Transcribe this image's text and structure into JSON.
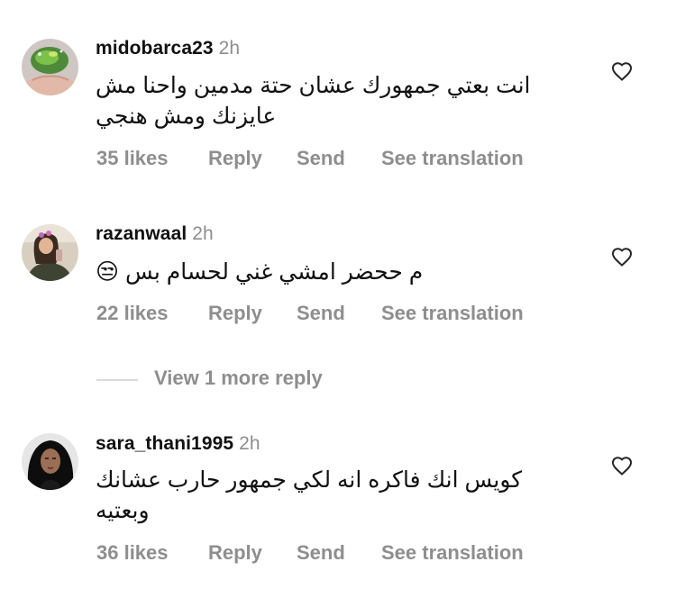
{
  "comments": [
    {
      "username": "midobarca23",
      "time": "2h",
      "text": "انت بعتي جمهورك عشان حتة مدمين واحنا مش عايزنك ومش هنجي",
      "likes": "35 likes",
      "reply": "Reply",
      "send": "Send",
      "translate": "See translation",
      "avatar": "globe-in-hand-avatar"
    },
    {
      "username": "razanwaal",
      "time": "2h",
      "text": "م ححضر امشي غني لحسام بس 😒",
      "likes": "22 likes",
      "reply": "Reply",
      "send": "Send",
      "translate": "See translation",
      "avatar": "selfie-avatar"
    },
    {
      "username": "sara_thani1995",
      "time": "2h",
      "text": "كويس انك فاكره انه لكي جمهور حارب عشانك وبعتيه",
      "likes": "36 likes",
      "reply": "Reply",
      "send": "Send",
      "translate": "See translation",
      "avatar": "hijab-illustration-avatar"
    }
  ],
  "view_more": "View 1 more reply",
  "colors": {
    "muted_text": "#8e8e8e",
    "divider": "#dbdbdb"
  },
  "icons": {
    "like": "heart-outline-icon"
  }
}
